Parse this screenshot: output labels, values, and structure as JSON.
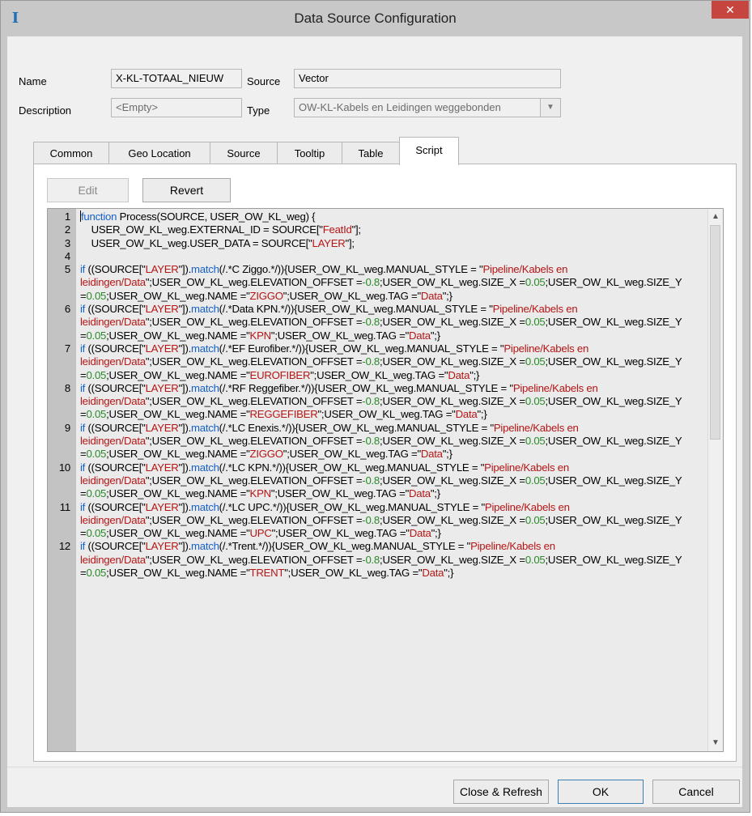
{
  "window": {
    "title": "Data Source Configuration",
    "close_glyph": "✕",
    "app_icon_glyph": "I"
  },
  "form": {
    "name_label": "Name",
    "name_value": "X-KL-TOTAAL_NIEUW",
    "source_label": "Source",
    "source_value": "Vector",
    "description_label": "Description",
    "description_value": "<Empty>",
    "type_label": "Type",
    "type_value": "OW-KL-Kabels en Leidingen weggebonden",
    "type_arrow_glyph": "▼"
  },
  "tabs": [
    {
      "label": "Common",
      "active": false
    },
    {
      "label": "Geo Location",
      "active": false
    },
    {
      "label": "Source",
      "active": false
    },
    {
      "label": "Tooltip",
      "active": false
    },
    {
      "label": "Table",
      "active": false
    },
    {
      "label": "Script",
      "active": true
    }
  ],
  "script_tab": {
    "edit_label": "Edit",
    "revert_label": "Revert"
  },
  "editor": {
    "scroll_up_glyph": "▲",
    "scroll_down_glyph": "▼",
    "lines": [
      {
        "n": "1",
        "text": "function Process(SOURCE, USER_OW_KL_weg) {"
      },
      {
        "n": "2",
        "text": "    USER_OW_KL_weg.EXTERNAL_ID = SOURCE[\"FeatId\"];"
      },
      {
        "n": "3",
        "text": "    USER_OW_KL_weg.USER_DATA = SOURCE[\"LAYER\"];"
      },
      {
        "n": "4",
        "text": ""
      },
      {
        "n": "5",
        "text": "if ((SOURCE[\"LAYER\"]).match(/.*C Ziggo.*/)){USER_OW_KL_weg.MANUAL_STYLE = \"Pipeline/Kabels en leidingen/Data\";USER_OW_KL_weg.ELEVATION_OFFSET =-0.8;USER_OW_KL_weg.SIZE_X =0.05;USER_OW_KL_weg.SIZE_Y =0.05;USER_OW_KL_weg.NAME =\"ZIGGO\";USER_OW_KL_weg.TAG =\"Data\";}"
      },
      {
        "n": "6",
        "text": "if ((SOURCE[\"LAYER\"]).match(/.*Data KPN.*/)){USER_OW_KL_weg.MANUAL_STYLE = \"Pipeline/Kabels en leidingen/Data\";USER_OW_KL_weg.ELEVATION_OFFSET =-0.8;USER_OW_KL_weg.SIZE_X =0.05;USER_OW_KL_weg.SIZE_Y =0.05;USER_OW_KL_weg.NAME =\"KPN\";USER_OW_KL_weg.TAG =\"Data\";}"
      },
      {
        "n": "7",
        "text": "if ((SOURCE[\"LAYER\"]).match(/.*EF Eurofiber.*/)){USER_OW_KL_weg.MANUAL_STYLE = \"Pipeline/Kabels en leidingen/Data\";USER_OW_KL_weg.ELEVATION_OFFSET =-0.8;USER_OW_KL_weg.SIZE_X =0.05;USER_OW_KL_weg.SIZE_Y =0.05;USER_OW_KL_weg.NAME =\"EUROFIBER\";USER_OW_KL_weg.TAG =\"Data\";}"
      },
      {
        "n": "8",
        "text": "if ((SOURCE[\"LAYER\"]).match(/.*RF Reggefiber.*/)){USER_OW_KL_weg.MANUAL_STYLE = \"Pipeline/Kabels en leidingen/Data\";USER_OW_KL_weg.ELEVATION_OFFSET =-0.8;USER_OW_KL_weg.SIZE_X =0.05;USER_OW_KL_weg.SIZE_Y =0.05;USER_OW_KL_weg.NAME =\"REGGEFIBER\";USER_OW_KL_weg.TAG =\"Data\";}"
      },
      {
        "n": "9",
        "text": "if ((SOURCE[\"LAYER\"]).match(/.*LC Enexis.*/)){USER_OW_KL_weg.MANUAL_STYLE = \"Pipeline/Kabels en leidingen/Data\";USER_OW_KL_weg.ELEVATION_OFFSET =-0.8;USER_OW_KL_weg.SIZE_X =0.05;USER_OW_KL_weg.SIZE_Y =0.05;USER_OW_KL_weg.NAME =\"ZIGGO\";USER_OW_KL_weg.TAG =\"Data\";}"
      },
      {
        "n": "10",
        "text": "if ((SOURCE[\"LAYER\"]).match(/.*LC KPN.*/)){USER_OW_KL_weg.MANUAL_STYLE = \"Pipeline/Kabels en leidingen/Data\";USER_OW_KL_weg.ELEVATION_OFFSET =-0.8;USER_OW_KL_weg.SIZE_X =0.05;USER_OW_KL_weg.SIZE_Y =0.05;USER_OW_KL_weg.NAME =\"KPN\";USER_OW_KL_weg.TAG =\"Data\";}"
      },
      {
        "n": "11",
        "text": "if ((SOURCE[\"LAYER\"]).match(/.*LC UPC.*/)){USER_OW_KL_weg.MANUAL_STYLE = \"Pipeline/Kabels en leidingen/Data\";USER_OW_KL_weg.ELEVATION_OFFSET =-0.8;USER_OW_KL_weg.SIZE_X =0.05;USER_OW_KL_weg.SIZE_Y =0.05;USER_OW_KL_weg.NAME =\"UPC\";USER_OW_KL_weg.TAG =\"Data\";}"
      },
      {
        "n": "12",
        "text": "if ((SOURCE[\"LAYER\"]).match(/.*Trent.*/)){USER_OW_KL_weg.MANUAL_STYLE = \"Pipeline/Kabels en leidingen/Data\";USER_OW_KL_weg.ELEVATION_OFFSET =-0.8;USER_OW_KL_weg.SIZE_X =0.05;USER_OW_KL_weg.SIZE_Y =0.05;USER_OW_KL_weg.NAME =\"TRENT\";USER_OW_KL_weg.TAG =\"Data\";}"
      }
    ]
  },
  "footer": {
    "close_refresh_label": "Close & Refresh",
    "ok_label": "OK",
    "cancel_label": "Cancel"
  },
  "colors": {
    "keyword": "#1560c8",
    "string": "#b51616",
    "number": "#2a8a2a",
    "close_button": "#c7453f"
  }
}
